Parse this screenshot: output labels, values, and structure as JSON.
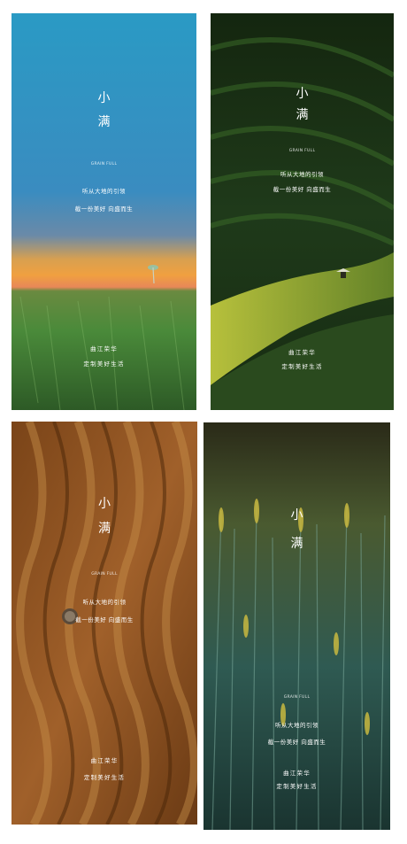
{
  "posters": [
    {
      "char1": "小",
      "char2": "满",
      "tag": "GRAIN FULL",
      "line1": "听从大地的引领",
      "line2": "截一份美好  向盛而生",
      "brand1": "曲江荣华",
      "brand2": "定制美好生活"
    },
    {
      "char1": "小",
      "char2": "满",
      "tag": "GRAIN FULL",
      "line1": "听从大地的引领",
      "line2": "截一份美好  向盛而生",
      "brand1": "曲江荣华",
      "brand2": "定制美好生活"
    },
    {
      "char1": "小",
      "char2": "满",
      "tag": "GRAIN FULL",
      "line1": "听从大地的引领",
      "line2": "截一份美好  向盛而生",
      "brand1": "曲江荣华",
      "brand2": "定制美好生活"
    },
    {
      "char1": "小",
      "char2": "满",
      "tag": "GRAIN FULL",
      "line1": "听从大地的引领",
      "line2": "截一份美好  向盛而生",
      "brand1": "曲江荣华",
      "brand2": "定制美好生活"
    }
  ],
  "colors": {
    "sky_top": "#2a8fbf",
    "sky_horizon": "#f0a040",
    "field_green": "#3f7a35",
    "terrace_dark": "#1f3a1c",
    "terrace_light": "#b8c838",
    "wheat_brown": "#9a5a24",
    "barley_teal": "#2f5a52",
    "barley_yellow": "#c8b840"
  }
}
